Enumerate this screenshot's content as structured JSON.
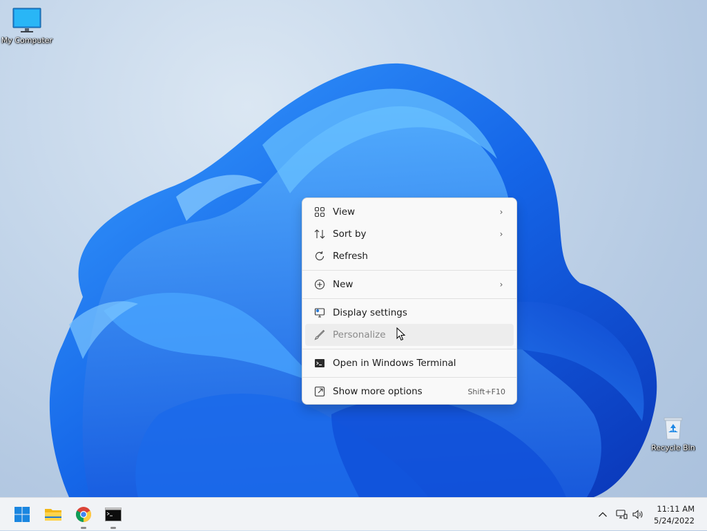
{
  "desktop": {
    "icons": [
      {
        "label": "My Computer",
        "icon": "monitor-icon"
      },
      {
        "label": "Recycle Bin",
        "icon": "recycle-bin-icon"
      }
    ]
  },
  "context_menu": {
    "items": [
      {
        "label": "View",
        "icon": "grid-icon",
        "submenu": true
      },
      {
        "label": "Sort by",
        "icon": "sort-icon",
        "submenu": true
      },
      {
        "label": "Refresh",
        "icon": "refresh-icon"
      },
      {
        "label": "New",
        "icon": "plus-circle-icon",
        "submenu": true
      },
      {
        "label": "Display settings",
        "icon": "display-settings-icon"
      },
      {
        "label": "Personalize",
        "icon": "brush-icon",
        "state": "hovered"
      },
      {
        "label": "Open in Windows Terminal",
        "icon": "terminal-icon"
      },
      {
        "label": "Show more options",
        "icon": "share-icon",
        "shortcut": "Shift+F10"
      }
    ]
  },
  "taskbar": {
    "apps": [
      {
        "name": "Start",
        "icon": "windows-start-icon"
      },
      {
        "name": "File Explorer",
        "icon": "folder-icon"
      },
      {
        "name": "Chrome",
        "icon": "chrome-icon",
        "running": true
      },
      {
        "name": "Command Prompt",
        "icon": "cmd-icon",
        "running": true
      }
    ],
    "tray": {
      "icons": [
        "chevron-up-icon",
        "network-icon",
        "volume-icon"
      ]
    },
    "clock": {
      "time": "11:11 AM",
      "date": "5/24/2022"
    }
  },
  "colors": {
    "accent": "#0067c0",
    "bloom_dark": "#0a3fc4",
    "bloom_light": "#2a8cff"
  }
}
